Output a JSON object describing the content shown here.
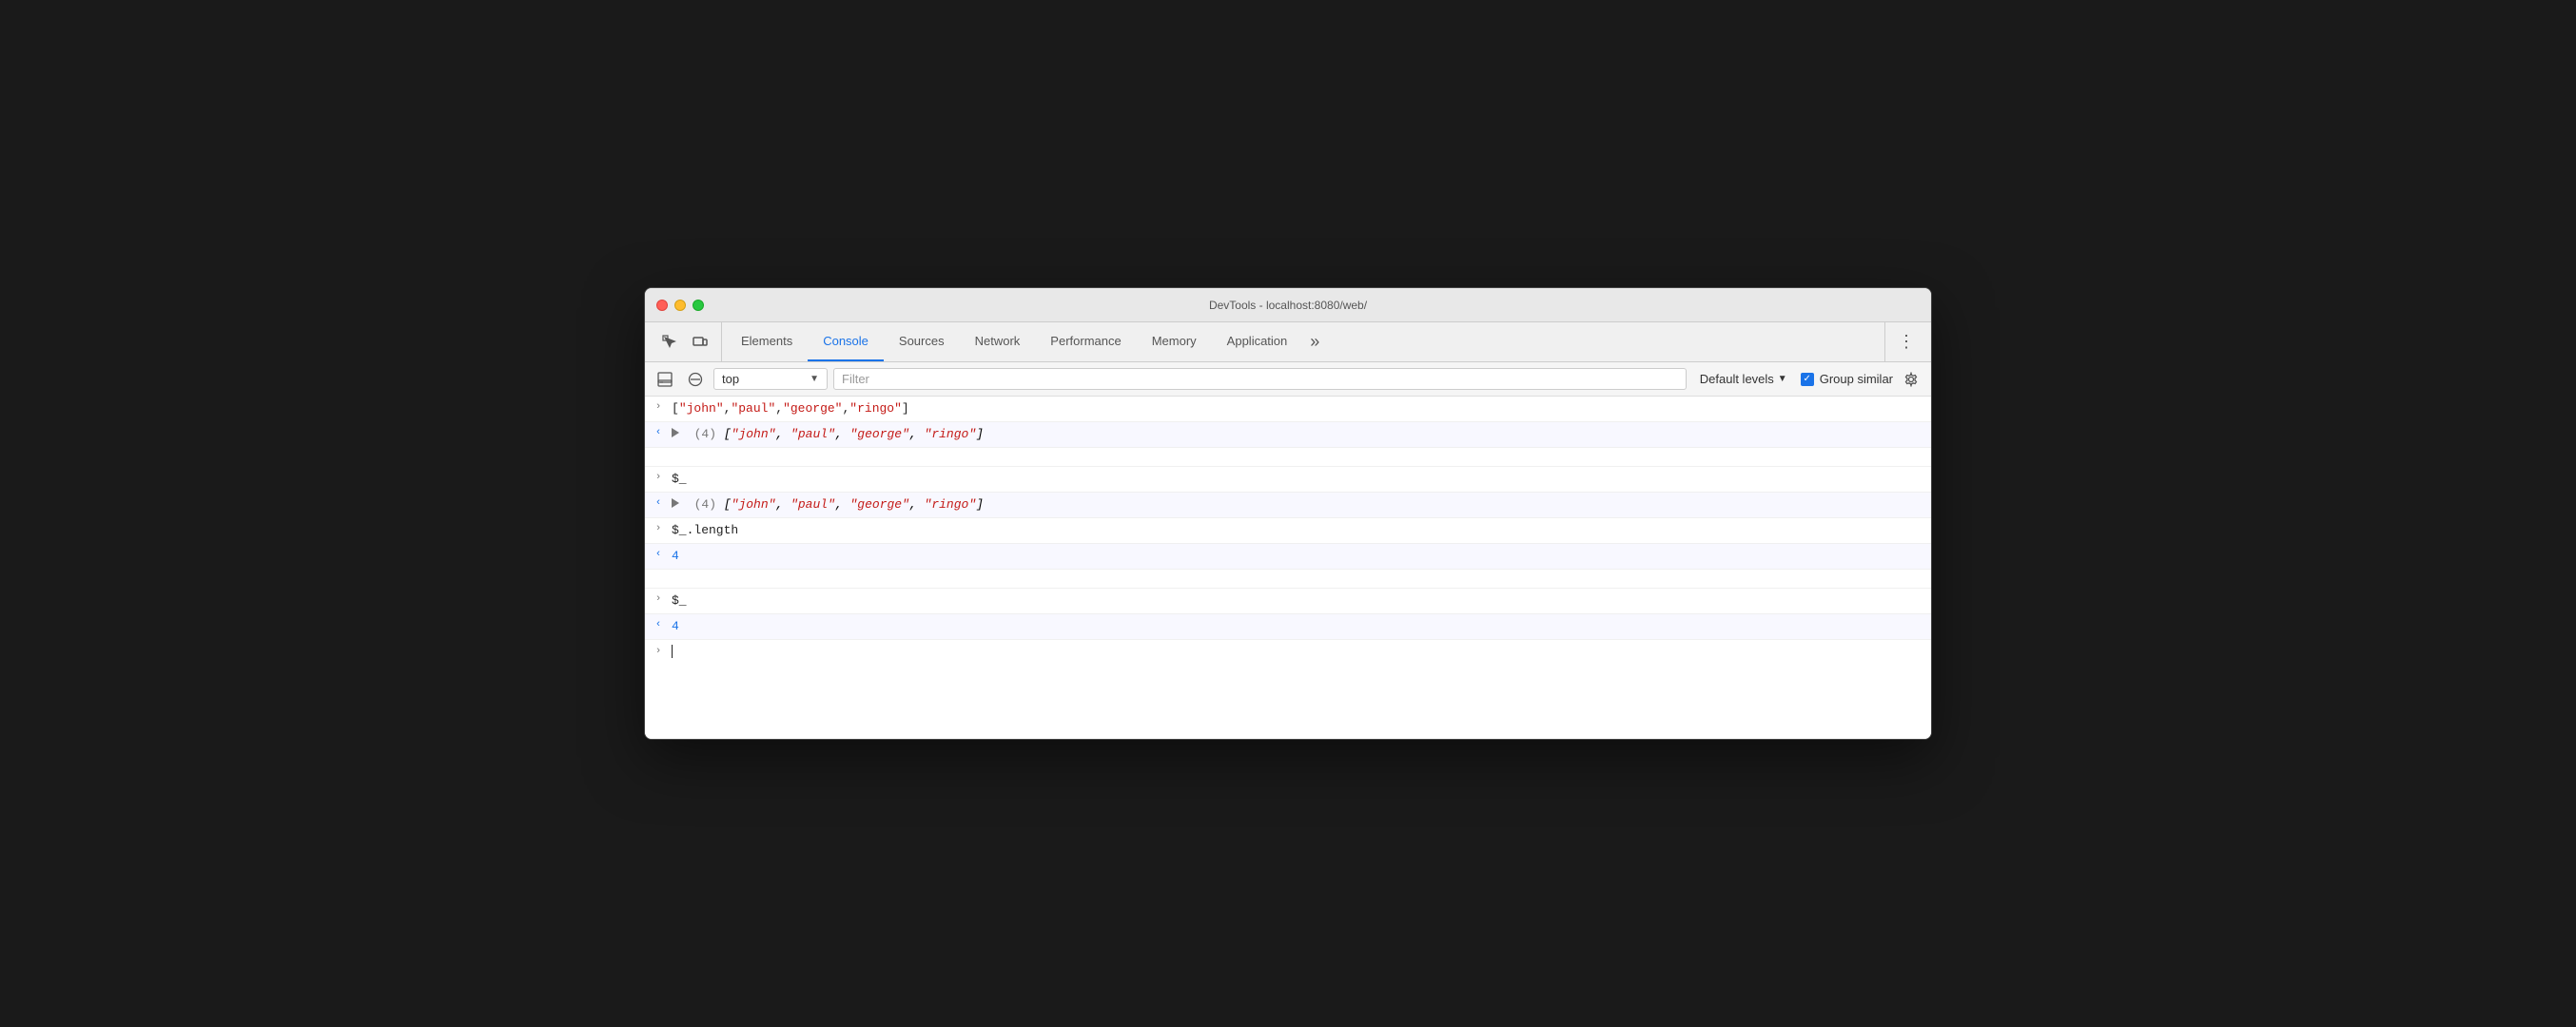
{
  "titleBar": {
    "title": "DevTools - localhost:8080/web/"
  },
  "tabs": {
    "items": [
      {
        "id": "elements",
        "label": "Elements",
        "active": false
      },
      {
        "id": "console",
        "label": "Console",
        "active": true
      },
      {
        "id": "sources",
        "label": "Sources",
        "active": false
      },
      {
        "id": "network",
        "label": "Network",
        "active": false
      },
      {
        "id": "performance",
        "label": "Performance",
        "active": false
      },
      {
        "id": "memory",
        "label": "Memory",
        "active": false
      },
      {
        "id": "application",
        "label": "Application",
        "active": false
      }
    ],
    "more_label": "»",
    "dots_label": "⋮"
  },
  "toolbar": {
    "context_value": "top",
    "filter_placeholder": "Filter",
    "levels_label": "Default levels",
    "group_similar_label": "Group similar"
  },
  "console": {
    "rows": [
      {
        "id": "row1",
        "type": "input",
        "arrow": ">",
        "text_plain": "[\"john\",\"paul\",\"george\",\"ringo\"]"
      },
      {
        "id": "row2",
        "type": "output_array",
        "arrow": "<",
        "count": "4",
        "items": [
          "\"john\"",
          "\"paul\"",
          "\"george\"",
          "\"ringo\""
        ]
      },
      {
        "id": "row3",
        "type": "input",
        "arrow": ">",
        "text_plain": "$_"
      },
      {
        "id": "row4",
        "type": "output_array",
        "arrow": "<",
        "count": "4",
        "items": [
          "\"john\"",
          "\"paul\"",
          "\"george\"",
          "\"ringo\""
        ]
      },
      {
        "id": "row5",
        "type": "input",
        "arrow": ">",
        "text_plain": "$_.length"
      },
      {
        "id": "row6",
        "type": "output_number",
        "arrow": "<",
        "value": "4"
      },
      {
        "id": "row7",
        "type": "input",
        "arrow": ">",
        "text_plain": "$_"
      },
      {
        "id": "row8",
        "type": "output_number",
        "arrow": "<",
        "value": "4"
      }
    ]
  }
}
